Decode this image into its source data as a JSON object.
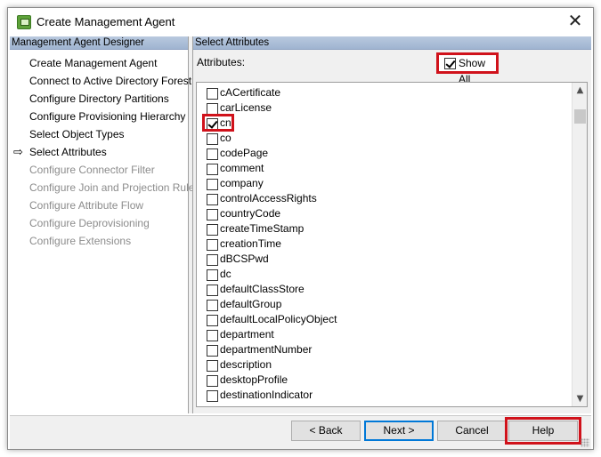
{
  "window": {
    "title": "Create Management Agent",
    "close_label": "✕"
  },
  "left_panel": {
    "header": "Management Agent Designer",
    "current_marker": "⇨",
    "items": [
      {
        "label": "Create Management Agent",
        "enabled": true,
        "current": false
      },
      {
        "label": "Connect to Active Directory Forest",
        "enabled": true,
        "current": false
      },
      {
        "label": "Configure Directory Partitions",
        "enabled": true,
        "current": false
      },
      {
        "label": "Configure Provisioning Hierarchy",
        "enabled": true,
        "current": false
      },
      {
        "label": "Select Object Types",
        "enabled": true,
        "current": false
      },
      {
        "label": "Select Attributes",
        "enabled": true,
        "current": true
      },
      {
        "label": "Configure Connector Filter",
        "enabled": false,
        "current": false
      },
      {
        "label": "Configure Join and Projection Rules",
        "enabled": false,
        "current": false
      },
      {
        "label": "Configure Attribute Flow",
        "enabled": false,
        "current": false
      },
      {
        "label": "Configure Deprovisioning",
        "enabled": false,
        "current": false
      },
      {
        "label": "Configure Extensions",
        "enabled": false,
        "current": false
      }
    ]
  },
  "right_panel": {
    "header": "Select Attributes",
    "attributes_label": "Attributes:",
    "show_all": {
      "label": "Show All",
      "checked": true
    },
    "attributes": [
      {
        "name": "cACertificate",
        "checked": false
      },
      {
        "name": "carLicense",
        "checked": false
      },
      {
        "name": "cn",
        "checked": true
      },
      {
        "name": "co",
        "checked": false
      },
      {
        "name": "codePage",
        "checked": false
      },
      {
        "name": "comment",
        "checked": false
      },
      {
        "name": "company",
        "checked": false
      },
      {
        "name": "controlAccessRights",
        "checked": false
      },
      {
        "name": "countryCode",
        "checked": false
      },
      {
        "name": "createTimeStamp",
        "checked": false
      },
      {
        "name": "creationTime",
        "checked": false
      },
      {
        "name": "dBCSPwd",
        "checked": false
      },
      {
        "name": "dc",
        "checked": false
      },
      {
        "name": "defaultClassStore",
        "checked": false
      },
      {
        "name": "defaultGroup",
        "checked": false
      },
      {
        "name": "defaultLocalPolicyObject",
        "checked": false
      },
      {
        "name": "department",
        "checked": false
      },
      {
        "name": "departmentNumber",
        "checked": false
      },
      {
        "name": "description",
        "checked": false
      },
      {
        "name": "desktopProfile",
        "checked": false
      },
      {
        "name": "destinationIndicator",
        "checked": false
      }
    ],
    "scroll_up_icon": "▲",
    "scroll_down_icon": "▼"
  },
  "footer": {
    "back_label": "< Back",
    "next_label": "Next >",
    "cancel_label": "Cancel",
    "help_label": "Help"
  },
  "colors": {
    "highlight_red": "#d0121b",
    "panel_header_blue": "#b9c9df",
    "disabled_text": "#8c8c8c"
  }
}
